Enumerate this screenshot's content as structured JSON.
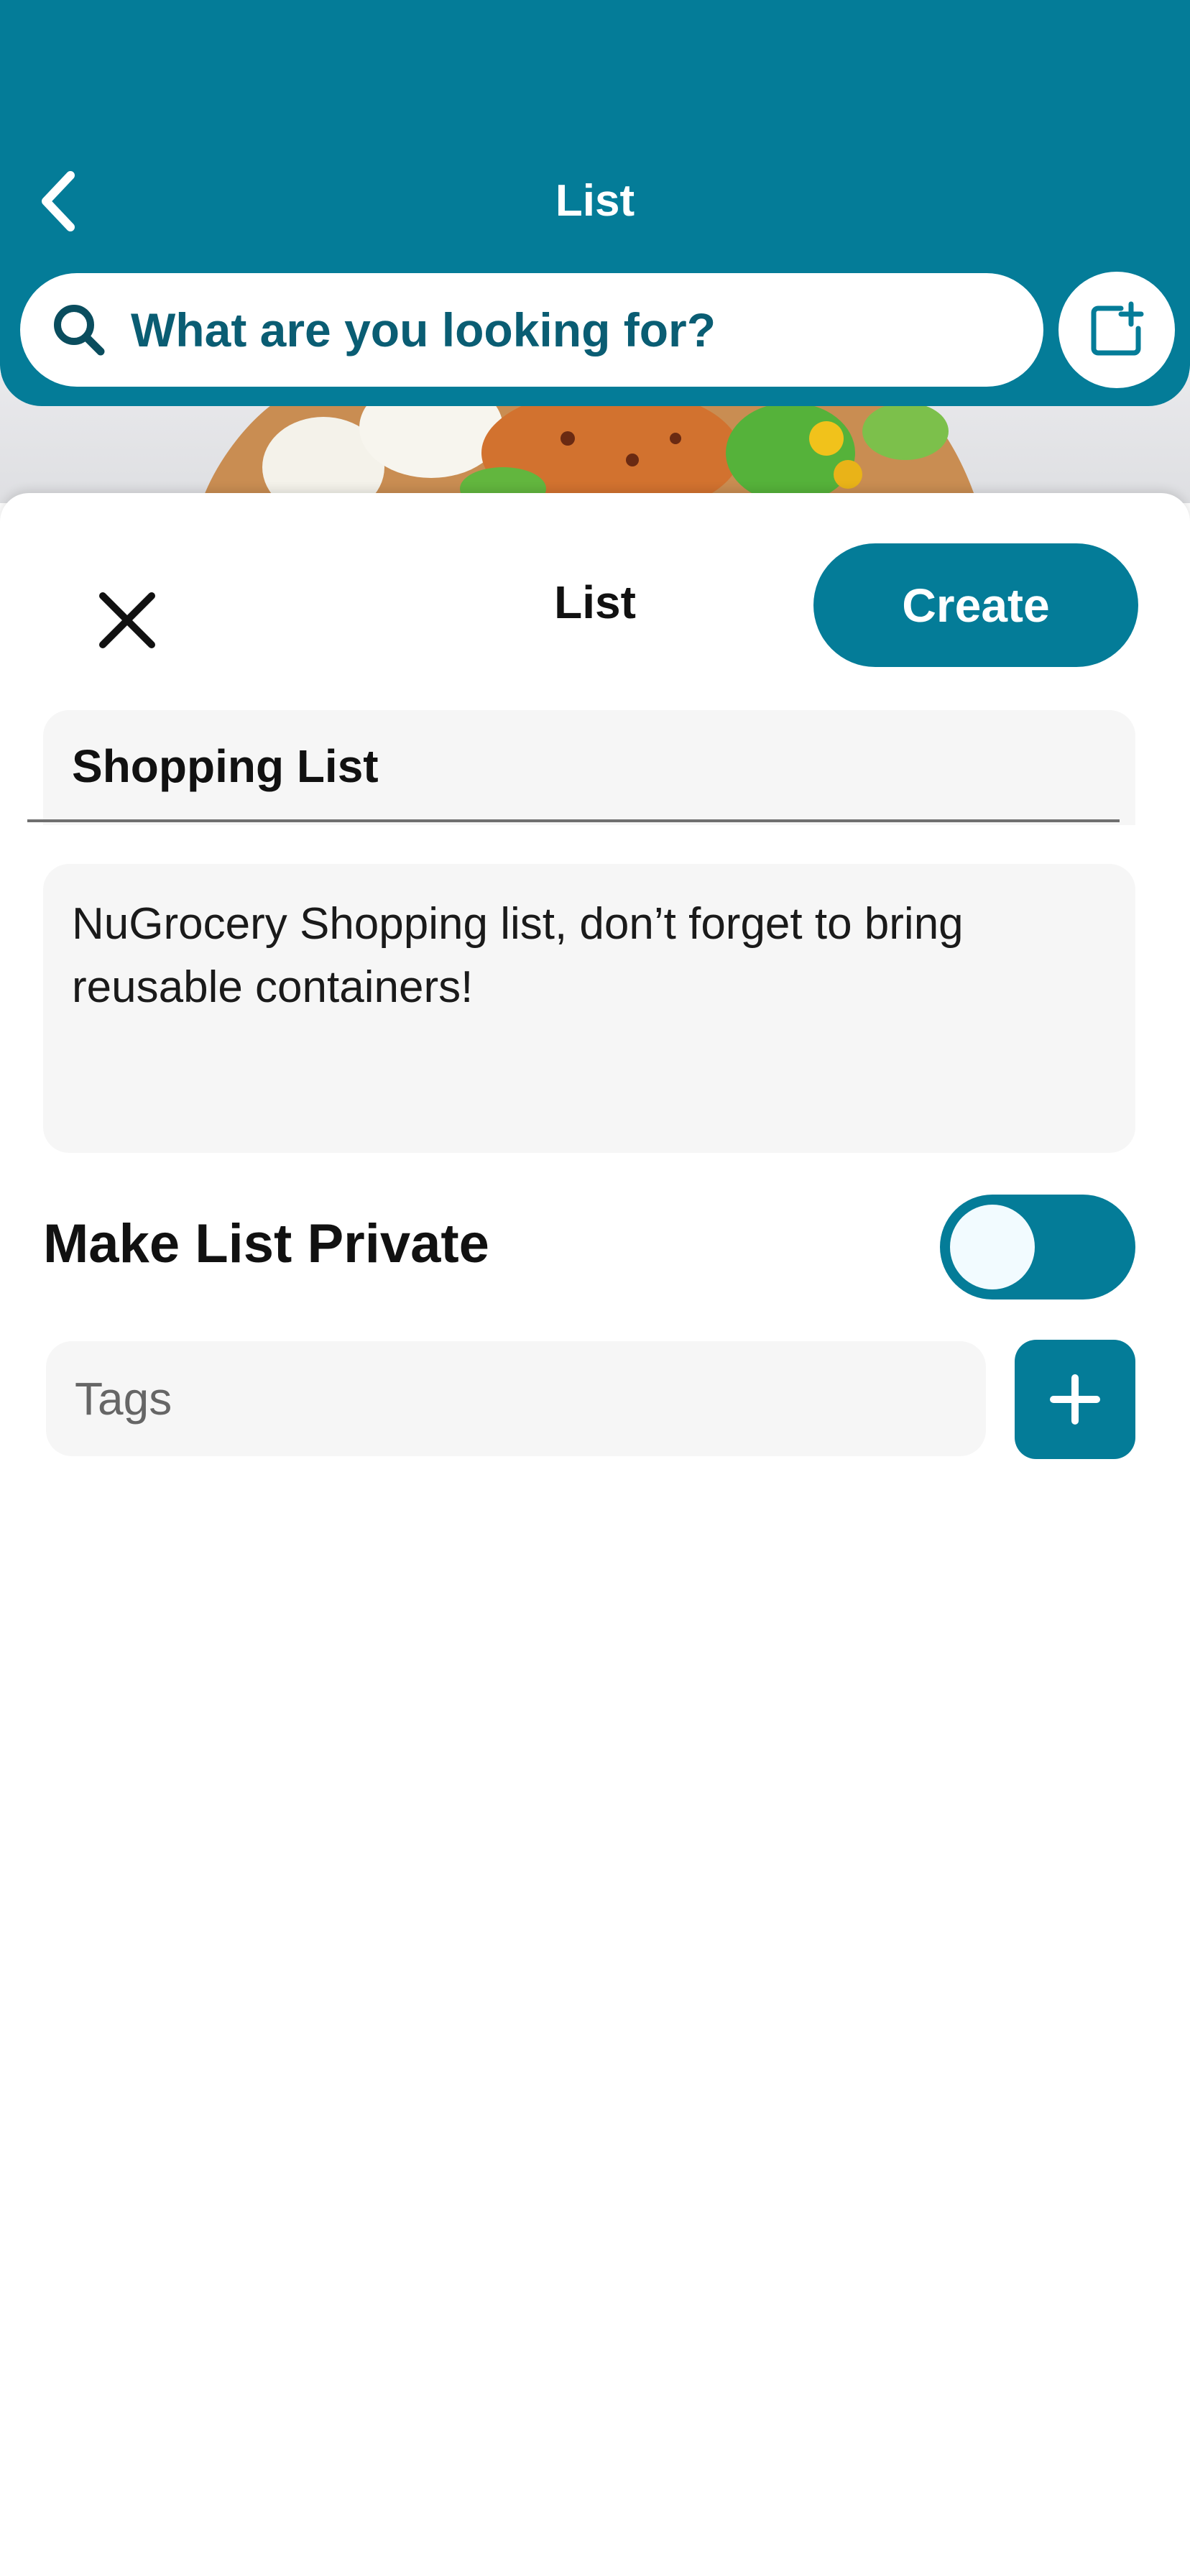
{
  "header": {
    "title": "List",
    "back_icon": "chevron-left-icon",
    "add_icon": "add-to-list-icon"
  },
  "search": {
    "placeholder": "What are you looking for?",
    "icon": "search-icon"
  },
  "sheet": {
    "title": "List",
    "close_icon": "close-icon",
    "create_label": "Create",
    "name_value": "Shopping List",
    "description_value": "NuGrocery Shopping list, don’t forget to bring reusable containers!",
    "private_label": "Make List Private",
    "private_enabled": false,
    "tags_placeholder": "Tags",
    "add_tag_icon": "plus-icon"
  },
  "colors": {
    "brand": "#047c98",
    "search_text": "#0a5d73",
    "field_bg": "#f6f6f6"
  }
}
